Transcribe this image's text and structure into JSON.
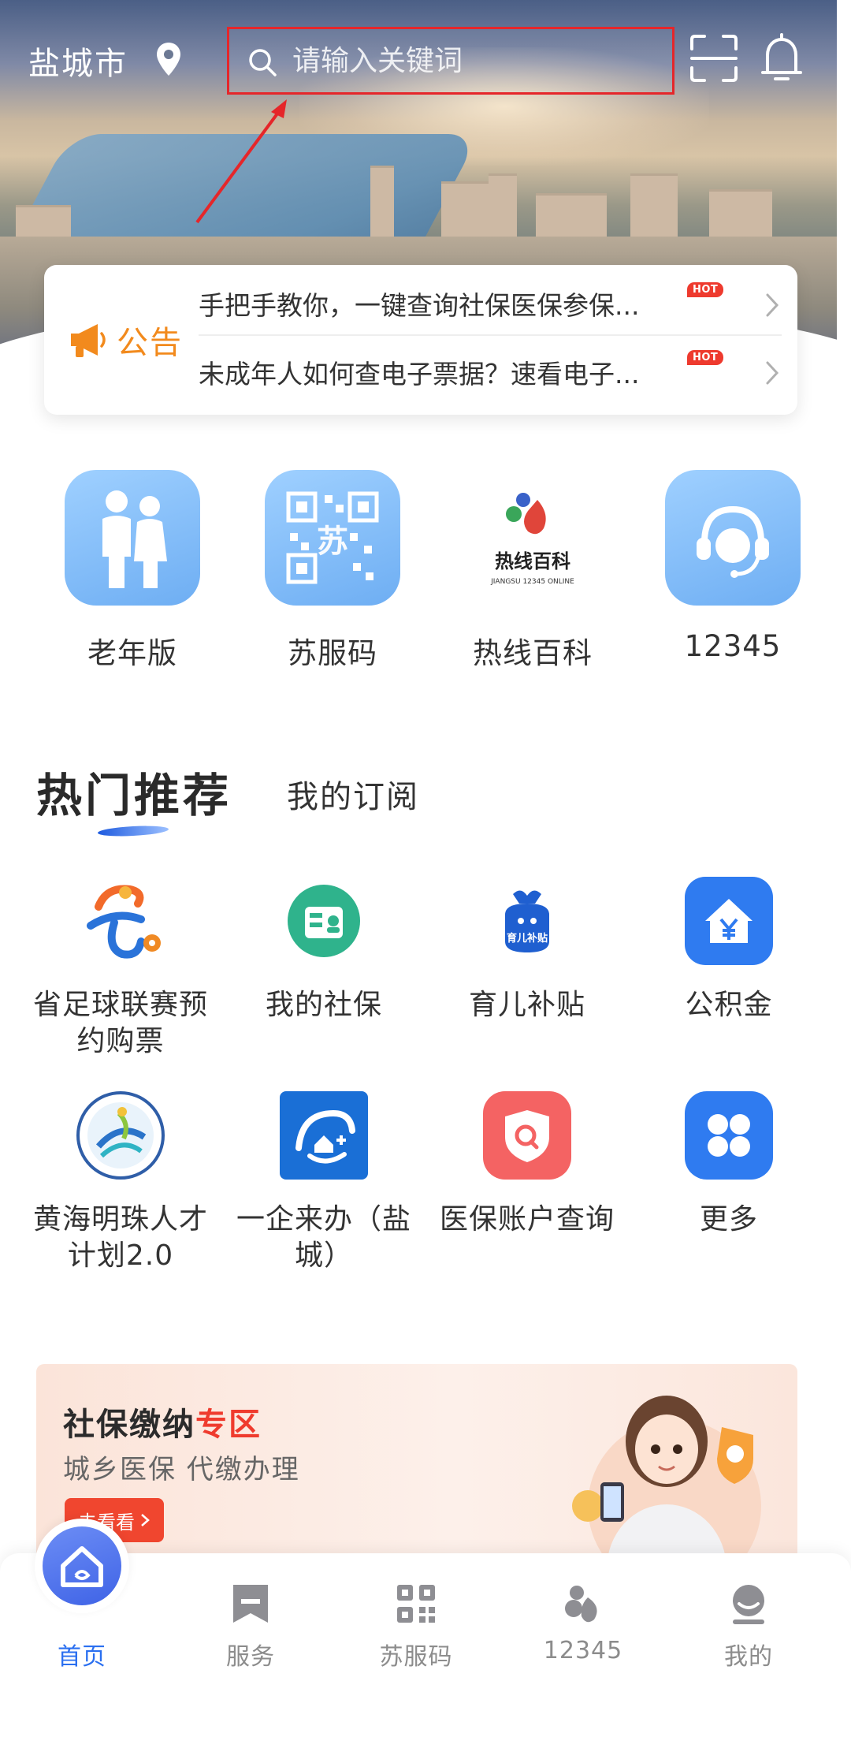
{
  "header": {
    "city": "盐城市",
    "search_placeholder": "请输入关键词"
  },
  "notice": {
    "tag": "公告",
    "items": [
      {
        "text": "手把手教你，一键查询社保医保参保...",
        "badge": "HOT"
      },
      {
        "text": "未成年人如何查电子票据？速看电子...",
        "badge": "HOT"
      }
    ]
  },
  "quick_entries": [
    {
      "label": "老年版",
      "icon": "elderly-couple-icon"
    },
    {
      "label": "苏服码",
      "icon": "qr-code-icon"
    },
    {
      "label": "热线百科",
      "icon": "hotline-encyclopedia-logo",
      "logo_text": "热线百科",
      "logo_sub": "JIANGSU 12345 ONLINE"
    },
    {
      "label": "12345",
      "icon": "headset-service-icon"
    }
  ],
  "tabs": {
    "active": "热门推荐",
    "other": "我的订阅"
  },
  "recommend": [
    {
      "label": "省足球联赛预约购票",
      "icon": "football-league-logo"
    },
    {
      "label": "我的社保",
      "icon": "social-security-icon"
    },
    {
      "label": "育儿补贴",
      "icon": "childcare-subsidy-icon",
      "icon_text": "育儿补贴"
    },
    {
      "label": "公积金",
      "icon": "housing-fund-icon"
    },
    {
      "label": "黄海明珠人才计划2.0",
      "icon": "talent-plan-logo"
    },
    {
      "label": "一企来办（盐城）",
      "icon": "enterprise-service-icon"
    },
    {
      "label": "医保账户查询",
      "icon": "medical-insurance-icon"
    },
    {
      "label": "更多",
      "icon": "more-grid-icon"
    }
  ],
  "banner": {
    "title_prefix": "社保缴纳",
    "title_highlight": "专区",
    "subtitle": "城乡医保 代缴办理",
    "button": "去看看"
  },
  "bottom_nav": [
    {
      "label": "首页",
      "icon": "home-icon",
      "active": true
    },
    {
      "label": "服务",
      "icon": "service-icon",
      "active": false
    },
    {
      "label": "苏服码",
      "icon": "qr-code-icon",
      "active": false
    },
    {
      "label": "12345",
      "icon": "hotline-icon",
      "active": false
    },
    {
      "label": "我的",
      "icon": "profile-icon",
      "active": false
    }
  ],
  "colors": {
    "accent": "#2a6ff0",
    "hot": "#ee3a2e",
    "notice": "#f28a1d",
    "search_border": "#e5262a"
  }
}
